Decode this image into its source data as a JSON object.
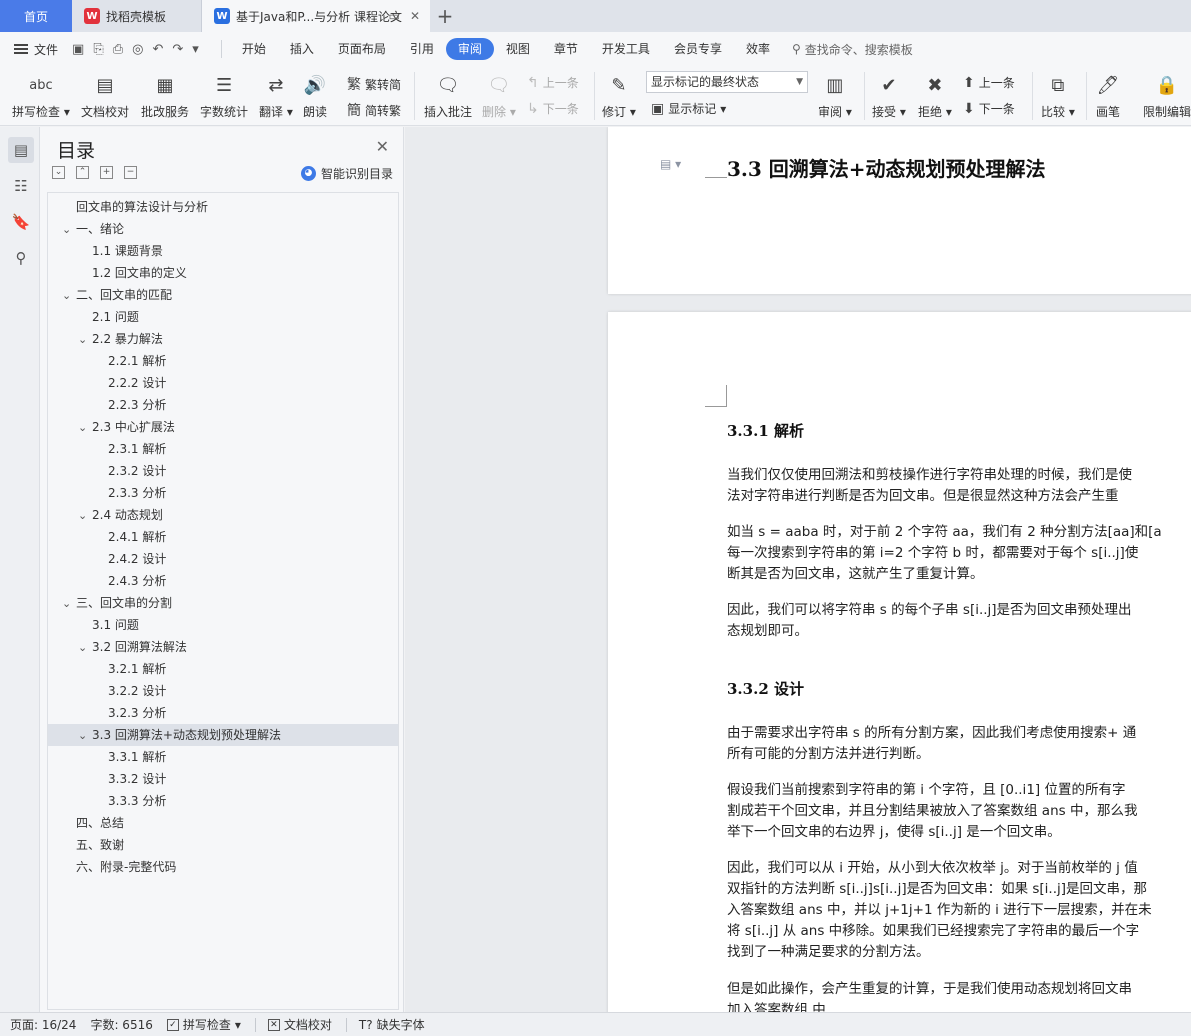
{
  "tabs": {
    "home": "首页",
    "template": "找稻壳模板",
    "document": "基于Java和P...与分析 课程论文",
    "new_tab": "+"
  },
  "menu": {
    "file": "文件",
    "items": [
      "开始",
      "插入",
      "页面布局",
      "引用",
      "审阅",
      "视图",
      "章节",
      "开发工具",
      "会员专享",
      "效率"
    ],
    "active": "审阅",
    "search": "查找命令、搜索模板"
  },
  "ribbon": {
    "spell_check": "拼写检查",
    "doc_proof": "文档校对",
    "review_service": "批改服务",
    "word_count": "字数统计",
    "translate": "翻译",
    "read_aloud": "朗读",
    "trad_to_simp": "繁转简",
    "simp_to_trad": "简转繁",
    "insert_comment": "插入批注",
    "delete": "删除",
    "prev_comment": "上一条",
    "next_comment": "下一条",
    "track_changes": "修订",
    "markup_select": "显示标记的最终状态",
    "show_markup": "显示标记",
    "review": "审阅",
    "accept": "接受",
    "reject": "拒绝",
    "prev_change": "上一条",
    "next_change": "下一条",
    "compare": "比较",
    "pen": "画笔",
    "restrict": "限制编辑",
    "spell_icon_text": "abc"
  },
  "toc": {
    "title": "目录",
    "smart": "智能识别目录",
    "items": [
      {
        "text": "回文串的算法设计与分析",
        "level": 0,
        "caret": ""
      },
      {
        "text": "一、绪论",
        "level": 0,
        "caret": "v"
      },
      {
        "text": "1.1  课题背景",
        "level": 1,
        "caret": ""
      },
      {
        "text": "1.2  回文串的定义",
        "level": 1,
        "caret": ""
      },
      {
        "text": "二、回文串的匹配",
        "level": 0,
        "caret": "v"
      },
      {
        "text": "2.1  问题",
        "level": 1,
        "caret": ""
      },
      {
        "text": "2.2  暴力解法",
        "level": 1,
        "caret": "v"
      },
      {
        "text": "2.2.1  解析",
        "level": 2,
        "caret": ""
      },
      {
        "text": "2.2.2  设计",
        "level": 2,
        "caret": ""
      },
      {
        "text": "2.2.3  分析",
        "level": 2,
        "caret": ""
      },
      {
        "text": "2.3  中心扩展法",
        "level": 1,
        "caret": "v"
      },
      {
        "text": "2.3.1  解析",
        "level": 2,
        "caret": ""
      },
      {
        "text": "2.3.2  设计",
        "level": 2,
        "caret": ""
      },
      {
        "text": "2.3.3  分析",
        "level": 2,
        "caret": ""
      },
      {
        "text": "2.4  动态规划",
        "level": 1,
        "caret": "v"
      },
      {
        "text": "2.4.1  解析",
        "level": 2,
        "caret": ""
      },
      {
        "text": "2.4.2  设计",
        "level": 2,
        "caret": ""
      },
      {
        "text": "2.4.3  分析",
        "level": 2,
        "caret": ""
      },
      {
        "text": "三、回文串的分割",
        "level": 0,
        "caret": "v"
      },
      {
        "text": "3.1  问题",
        "level": 1,
        "caret": ""
      },
      {
        "text": "3.2  回溯算法解法",
        "level": 1,
        "caret": "v"
      },
      {
        "text": "3.2.1  解析",
        "level": 2,
        "caret": ""
      },
      {
        "text": "3.2.2  设计",
        "level": 2,
        "caret": ""
      },
      {
        "text": "3.2.3  分析",
        "level": 2,
        "caret": ""
      },
      {
        "text": "3.3  回溯算法+动态规划预处理解法",
        "level": 1,
        "caret": "v",
        "selected": true
      },
      {
        "text": "3.3.1  解析",
        "level": 2,
        "caret": ""
      },
      {
        "text": "3.3.2  设计",
        "level": 2,
        "caret": ""
      },
      {
        "text": "3.3.3  分析",
        "level": 2,
        "caret": ""
      },
      {
        "text": "四、总结",
        "level": 0,
        "caret": ""
      },
      {
        "text": "五、致谢",
        "level": 0,
        "caret": ""
      },
      {
        "text": "六、附录-完整代码",
        "level": 0,
        "caret": ""
      }
    ]
  },
  "document": {
    "heading_33": "3.3  回溯算法+动态规划预处理解法",
    "heading_331": "3.3.1  解析",
    "p1": [
      "当我们仅仅使用回溯法和剪枝操作进行字符串处理的时候，我们是使",
      "法对字符串进行判断是否为回文串。但是很显然这种方法会产生重"
    ],
    "p2": [
      "如当 s = aaba 时，对于前 2 个字符 aa，我们有 2 种分割方法[aa]和[a",
      "每一次搜索到字符串的第 i=2 个字符 b 时，都需要对于每个 s[i..j]使",
      "断其是否为回文串，这就产生了重复计算。"
    ],
    "p3": [
      "因此，我们可以将字符串 s 的每个子串 s[i..j]是否为回文串预处理出",
      "态规划即可。"
    ],
    "heading_332": "3.3.2  设计",
    "p4": [
      "由于需要求出字符串 s 的所有分割方案，因此我们考虑使用搜索+ 通",
      "所有可能的分割方法并进行判断。"
    ],
    "p5": [
      "假设我们当前搜索到字符串的第 i 个字符，且  [0..i1]  位置的所有字",
      "割成若干个回文串，并且分割结果被放入了答案数组 ans  中，那么我",
      "举下一个回文串的右边界  j，使得 s[i..j]  是一个回文串。"
    ],
    "p6": [
      "因此，我们可以从 i 开始，从小到大依次枚举 j。对于当前枚举的 j 值",
      "双指针的方法判断 s[i..j]s[i..j]是否为回文串：如果 s[i..j]是回文串，那",
      "入答案数组 ans 中，并以 j+1j+1 作为新的 i 进行下一层搜索，并在未",
      "将 s[i..j]  从 ans  中移除。如果我们已经搜索完了字符串的最后一个字",
      "找到了一种满足要求的分割方法。"
    ],
    "p7": [
      "但是如此操作，会产生重复的计算，于是我们使用动态规划将回文串",
      "加入答案数组     中"
    ]
  },
  "status": {
    "page": "页面: 16/24",
    "words": "字数: 6516",
    "spell": "拼写检查",
    "proof": "文档校对",
    "font": "缺失字体"
  }
}
